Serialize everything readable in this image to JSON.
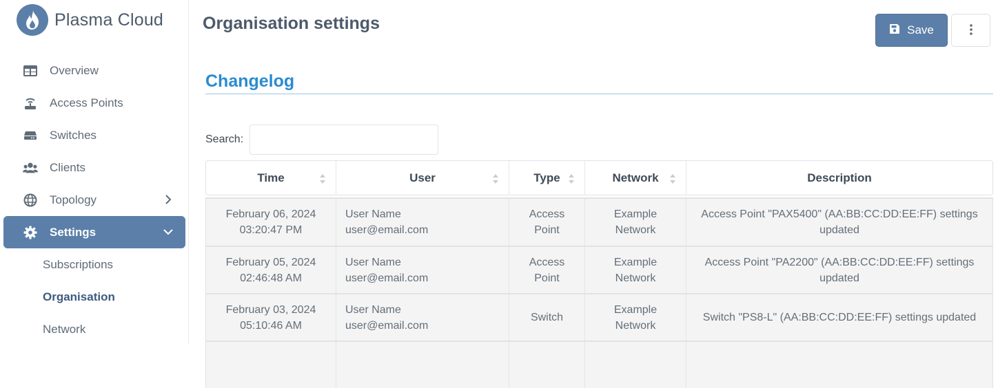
{
  "brand": {
    "name": "Plasma Cloud"
  },
  "nav": {
    "items": [
      {
        "label": "Overview",
        "icon": "table-icon"
      },
      {
        "label": "Access Points",
        "icon": "access-point-icon"
      },
      {
        "label": "Switches",
        "icon": "switch-icon"
      },
      {
        "label": "Clients",
        "icon": "users-icon"
      },
      {
        "label": "Topology",
        "icon": "globe-icon"
      },
      {
        "label": "Settings",
        "icon": "gear-icon"
      }
    ],
    "sub_items": [
      {
        "label": "Subscriptions"
      },
      {
        "label": "Organisation"
      },
      {
        "label": "Network"
      }
    ]
  },
  "header": {
    "title": "Organisation settings",
    "save_label": "Save"
  },
  "section": {
    "title": "Changelog"
  },
  "search": {
    "label": "Search:",
    "value": ""
  },
  "table": {
    "columns": [
      "Time",
      "User",
      "Type",
      "Network",
      "Description"
    ],
    "rows": [
      {
        "date": "February 06, 2024",
        "time": "03:20:47 PM",
        "user_name": "User Name",
        "user_email": "user@email.com",
        "type_1": "Access",
        "type_2": "Point",
        "network_1": "Example",
        "network_2": "Network",
        "desc_1": "Access Point \"PAX5400\" (AA:BB:CC:DD:EE:FF) settings",
        "desc_2": "updated"
      },
      {
        "date": "February 05, 2024",
        "time": "02:46:48 AM",
        "user_name": "User Name",
        "user_email": "user@email.com",
        "type_1": "Access",
        "type_2": "Point",
        "network_1": "Example",
        "network_2": "Network",
        "desc_1": "Access Point \"PA2200\" (AA:BB:CC:DD:EE:FF) settings",
        "desc_2": "updated"
      },
      {
        "date": "February 03, 2024",
        "time": "05:10:46 AM",
        "user_name": "User Name",
        "user_email": "user@email.com",
        "type_1": "Switch",
        "type_2": "",
        "network_1": "Example",
        "network_2": "Network",
        "desc_1": "Switch \"PS8-L\" (AA:BB:CC:DD:EE:FF) settings updated",
        "desc_2": ""
      }
    ]
  },
  "colors": {
    "accent": "#5b7fa8",
    "link": "#2a8ccf"
  }
}
